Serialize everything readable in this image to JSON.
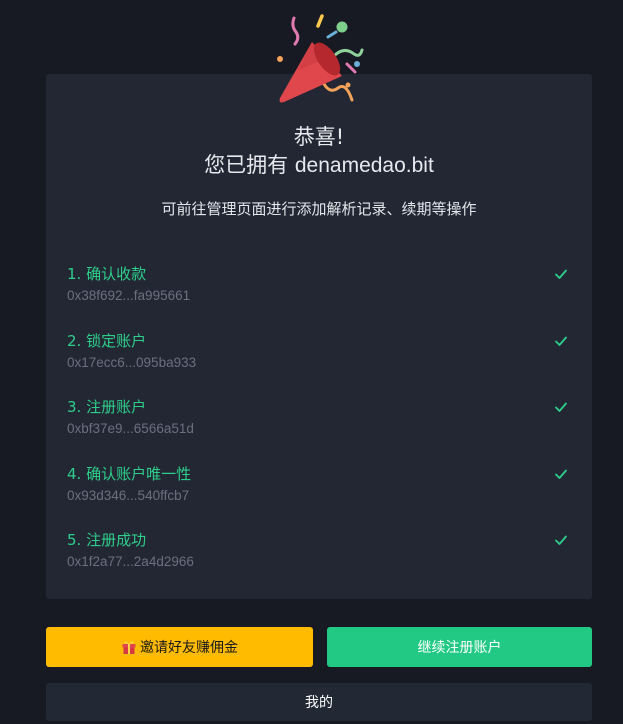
{
  "header": {
    "icon": "party-popper-icon"
  },
  "card": {
    "title": "恭喜!",
    "subtitle_prefix": "您已拥有 ",
    "domain": "denamedao.bit",
    "hint": "可前往管理页面进行添加解析记录、续期等操作"
  },
  "steps": [
    {
      "title": "1. 确认收款",
      "hash": "0x38f692...fa995661",
      "status": "done"
    },
    {
      "title": "2. 锁定账户",
      "hash": "0x17ecc6...095ba933",
      "status": "done"
    },
    {
      "title": "3. 注册账户",
      "hash": "0xbf37e9...6566a51d",
      "status": "done"
    },
    {
      "title": "4. 确认账户唯一性",
      "hash": "0x93d346...540ffcb7",
      "status": "done"
    },
    {
      "title": "5. 注册成功",
      "hash": "0x1f2a77...2a4d2966",
      "status": "done"
    }
  ],
  "actions": {
    "invite_label": "邀请好友赚佣金",
    "continue_label": "继续注册账户",
    "mine_label": "我的"
  },
  "colors": {
    "background": "#171a23",
    "card": "#222733",
    "success": "#2ecf8a",
    "invite_button": "#ffbb00",
    "continue_button": "#21c984"
  }
}
